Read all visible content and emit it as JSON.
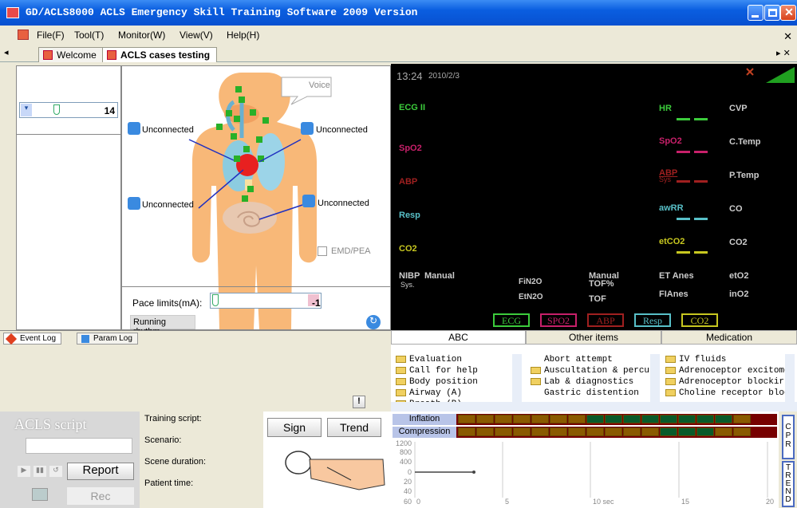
{
  "window": {
    "title": "GD/ACLS8000 ACLS Emergency Skill Training Software 2009 Version"
  },
  "menu": [
    "File(F)",
    "Tool(T)",
    "Monitor(W)",
    "View(V)",
    "Help(H)"
  ],
  "tabs": [
    {
      "label": "Welcome"
    },
    {
      "label": "ACLS cases testing"
    }
  ],
  "left": {
    "value": "14"
  },
  "body_panel": {
    "voice": "Voice",
    "sensors": [
      "Unconnected",
      "Unconnected",
      "Unconnected",
      "Unconnected"
    ],
    "emd_label": "EMD/PEA",
    "pace_label": "Pace limits(mA):",
    "pace_value": "-1",
    "running_rhythm": "Running rhythm"
  },
  "monitor": {
    "time": "13:24",
    "date": "2010/2/3",
    "waves": [
      "ECG II",
      "SpO2",
      "ABP",
      "Resp",
      "CO2"
    ],
    "params_mid": [
      {
        "name": "HR",
        "color": "#3ccc3c"
      },
      {
        "name": "SpO2",
        "color": "#c8206a"
      },
      {
        "name": "ABP",
        "sub": "Sys",
        "color": "#a02020"
      },
      {
        "name": "awRR",
        "color": "#58c0c8"
      },
      {
        "name": "etCO2",
        "color": "#c8c820"
      }
    ],
    "params_right": [
      "CVP",
      "C.Temp",
      "P.Temp",
      "CO",
      "CO2"
    ],
    "bottom": {
      "nibp": "NIBP",
      "manual": "Manual",
      "sys": "Sys.",
      "fin2o": "FiN2O",
      "etn2o": "EtN2O",
      "manual_tof": "Manual",
      "tof_pct": "TOF%",
      "tof": "TOF",
      "et_anes": "ET Anes",
      "fi_anes": "FIAnes",
      "eto2": "etO2",
      "ino2": "inO2"
    },
    "buttons": [
      "ECG",
      "SPO2",
      "ABP",
      "Resp",
      "CO2"
    ],
    "colors": {
      "ecg": "#3ccc3c",
      "spo2": "#c8206a",
      "abp": "#a02020",
      "resp": "#58c0c8",
      "co2": "#c8c820"
    }
  },
  "logtabs": [
    "Event Log",
    "Param Log"
  ],
  "log_excl": "!",
  "abc": {
    "tabs": [
      "ABC",
      "Other items",
      "Medication"
    ],
    "col1": [
      "Evaluation",
      "Call for help",
      "Body position",
      "Airway (A)",
      "Breath (B)"
    ],
    "col2": [
      "Abort attempt",
      "Auscultation & percuss",
      "Lab & diagnostics",
      "Gastric distention"
    ],
    "col3": [
      "IV fluids",
      "Adrenoceptor excitomot",
      "Adrenoceptor blockir",
      "Choline receptor block"
    ]
  },
  "script": {
    "title": "ACLS script",
    "labels": [
      "Training script:",
      "Scenario:",
      "Scene duration:",
      "Patient time:"
    ],
    "report": "Report",
    "rec": "Rec",
    "sign": "Sign",
    "trend": "Trend"
  },
  "cpr": {
    "inflation": "Inflation",
    "compression": "Compression",
    "yaxis": [
      "1200",
      "800",
      "400",
      "0",
      "20",
      "40",
      "60"
    ],
    "xaxis": [
      "0",
      "5",
      "10 sec",
      "15",
      "20"
    ],
    "side1": "CPR",
    "side2": "TREND"
  }
}
